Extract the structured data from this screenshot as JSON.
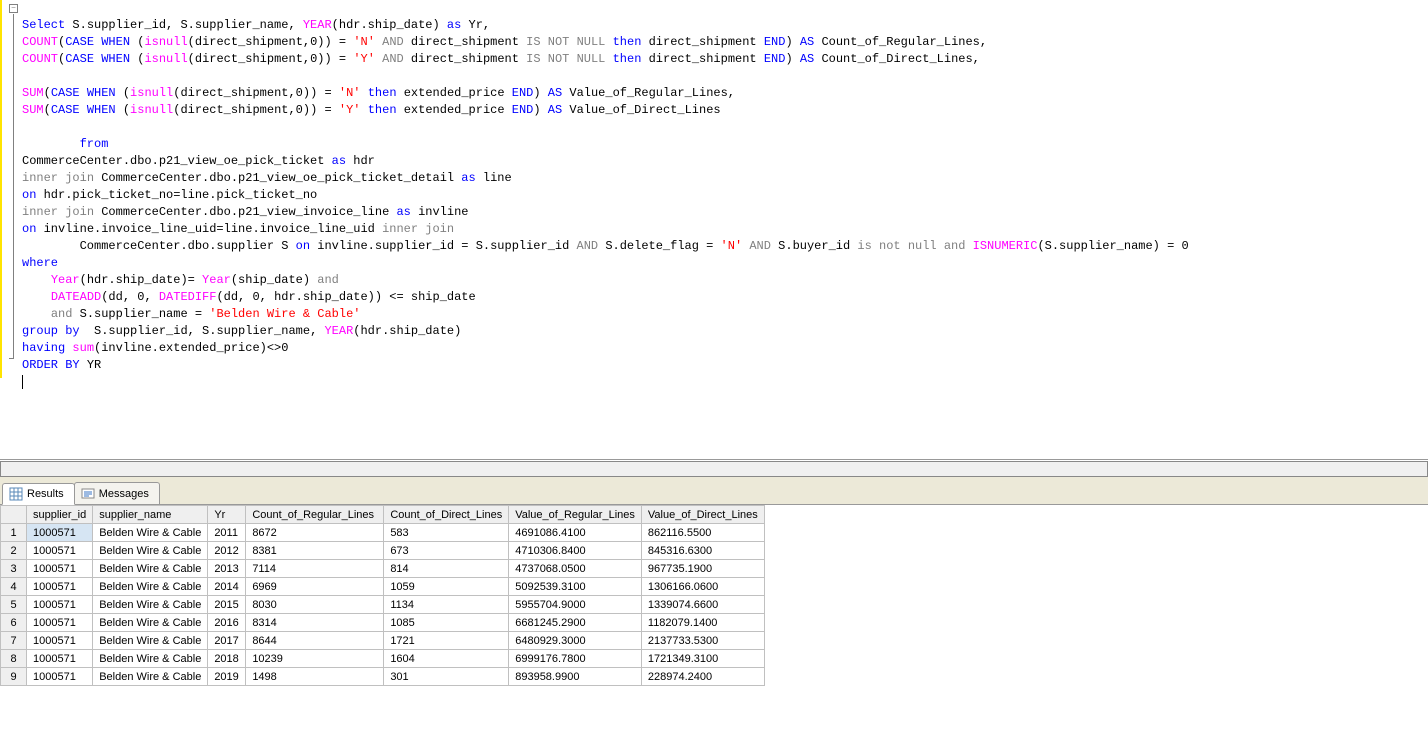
{
  "tabs": {
    "results": "Results",
    "messages": "Messages"
  },
  "sql": {
    "l1a": "Select",
    "l1b": " S.supplier_id, S.supplier_name, ",
    "l1c": "YEAR",
    "l1d": "(hdr.ship_date) ",
    "l1e": "as",
    "l1f": " Yr,",
    "l2a": "COUNT",
    "l2b": "(",
    "l2c": "CASE",
    "l2d": " ",
    "l2e": "WHEN",
    "l2f": " (",
    "l2g": "isnull",
    "l2h": "(direct_shipment,0)) = ",
    "l2i": "'N'",
    "l2j": " ",
    "l2k": "AND",
    "l2l": " direct_shipment ",
    "l2m": "IS",
    "l2n": " ",
    "l2o": "NOT",
    "l2p": " ",
    "l2q": "NULL",
    "l2r": " ",
    "l2s": "then",
    "l2t": " direct_shipment ",
    "l2u": "END",
    "l2v": ") ",
    "l2w": "AS",
    "l2x": " Count_of_Regular_Lines,",
    "l3i": "'Y'",
    "l3x": " Count_of_Direct_Lines,",
    "l5a": "SUM",
    "l5t": " extended_price ",
    "l5x": " Value_of_Regular_Lines,",
    "l6x": " Value_of_Direct_Lines",
    "l8a": "from",
    "l9a": "CommerceCenter.dbo.p21_view_oe_pick_ticket ",
    "l9b": "as",
    "l9c": " hdr",
    "l10a": "inner",
    "l10b": " ",
    "l10c": "join",
    "l10d": " CommerceCenter.dbo.p21_view_oe_pick_ticket_detail ",
    "l10e": "as",
    "l10f": " line",
    "l11a": "on",
    "l11b": " hdr.pick_ticket_no=line.pick_ticket_no",
    "l12d": " CommerceCenter.dbo.p21_view_invoice_line ",
    "l12f": " invline",
    "l13b": " invline.invoice_line_uid=line.invoice_line_uid ",
    "l13c": "inner",
    "l13d": " ",
    "l13e": "join",
    "l14a": "        CommerceCenter.dbo.supplier S ",
    "l14b": "on",
    "l14c": " invline.supplier_id = S.supplier_id ",
    "l14d": "AND",
    "l14e": " S.delete_flag = ",
    "l14f": "'N'",
    "l14g": " ",
    "l14h": "AND",
    "l14i": " S.buyer_id ",
    "l14j": "is",
    "l14k": " ",
    "l14l": "not",
    "l14m": " ",
    "l14n": "null",
    "l14o": " ",
    "l14p": "and",
    "l14q": " ",
    "l14r": "ISNUMERIC",
    "l14s": "(S.supplier_name) = 0",
    "l15a": "where",
    "l16a": "    ",
    "l16b": "Year",
    "l16c": "(hdr.ship_date)= ",
    "l16d": "Year",
    "l16e": "(ship_date) ",
    "l16f": "and",
    "l17a": "    ",
    "l17b": "DATEADD",
    "l17c": "(dd, 0, ",
    "l17d": "DATEDIFF",
    "l17e": "(dd, 0, hdr.ship_date)) <= ship_date",
    "l18a": "    ",
    "l18b": "and",
    "l18c": " S.supplier_name = ",
    "l18d": "'Belden Wire & Cable'",
    "l19a": "group",
    "l19b": " ",
    "l19c": "by",
    "l19d": "  S.supplier_id, S.supplier_name, ",
    "l19e": "YEAR",
    "l19f": "(hdr.ship_date)",
    "l20a": "having",
    "l20b": " ",
    "l20c": "sum",
    "l20d": "(invline.extended_price)<>0",
    "l21a": "ORDER",
    "l21b": " ",
    "l21c": "BY",
    "l21d": " YR"
  },
  "columns": [
    "supplier_id",
    "supplier_name",
    "Yr",
    "Count_of_Regular_Lines",
    "Count_of_Direct_Lines",
    "Value_of_Regular_Lines",
    "Value_of_Direct_Lines"
  ],
  "rows": [
    [
      "1000571",
      "Belden Wire & Cable",
      "2011",
      "8672",
      "583",
      "4691086.4100",
      "862116.5500"
    ],
    [
      "1000571",
      "Belden Wire & Cable",
      "2012",
      "8381",
      "673",
      "4710306.8400",
      "845316.6300"
    ],
    [
      "1000571",
      "Belden Wire & Cable",
      "2013",
      "7114",
      "814",
      "4737068.0500",
      "967735.1900"
    ],
    [
      "1000571",
      "Belden Wire & Cable",
      "2014",
      "6969",
      "1059",
      "5092539.3100",
      "1306166.0600"
    ],
    [
      "1000571",
      "Belden Wire & Cable",
      "2015",
      "8030",
      "1134",
      "5955704.9000",
      "1339074.6600"
    ],
    [
      "1000571",
      "Belden Wire & Cable",
      "2016",
      "8314",
      "1085",
      "6681245.2900",
      "1182079.1400"
    ],
    [
      "1000571",
      "Belden Wire & Cable",
      "2017",
      "8644",
      "1721",
      "6480929.3000",
      "2137733.5300"
    ],
    [
      "1000571",
      "Belden Wire & Cable",
      "2018",
      "10239",
      "1604",
      "6999176.7800",
      "1721349.3100"
    ],
    [
      "1000571",
      "Belden Wire & Cable",
      "2019",
      "1498",
      "301",
      "893958.9900",
      "228974.2400"
    ]
  ]
}
